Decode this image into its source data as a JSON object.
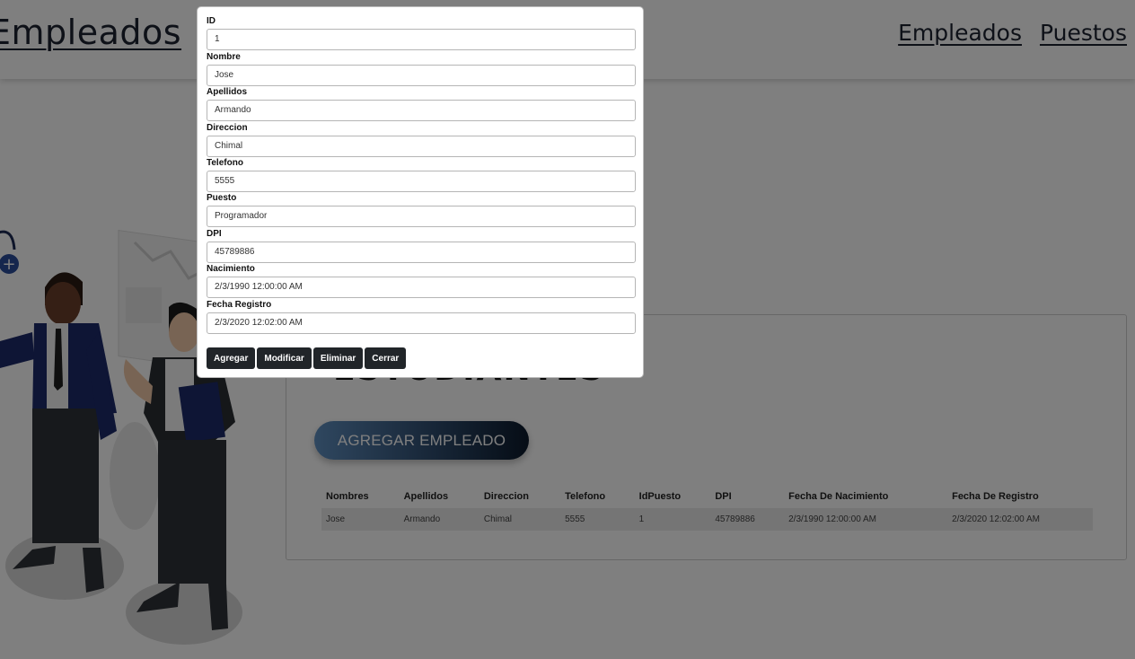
{
  "header": {
    "brand": "Empleados",
    "nav": [
      "Empleados",
      "Puestos"
    ]
  },
  "card": {
    "title": "ESTUDIANTES",
    "add_button": "AGREGAR EMPLEADO",
    "table": {
      "headers": [
        "Nombres",
        "Apellidos",
        "Direccion",
        "Telefono",
        "IdPuesto",
        "DPI",
        "Fecha De Nacimiento",
        "Fecha De Registro"
      ],
      "rows": [
        [
          "Jose",
          "Armando",
          "Chimal",
          "5555",
          "1",
          "45789886",
          "2/3/1990 12:00:00 AM",
          "2/3/2020 12:02:00 AM"
        ]
      ]
    }
  },
  "modal": {
    "fields": [
      {
        "label": "ID",
        "value": "1"
      },
      {
        "label": "Nombre",
        "value": "Jose"
      },
      {
        "label": "Apellidos",
        "value": "Armando"
      },
      {
        "label": "Direccion",
        "value": "Chimal"
      },
      {
        "label": "Telefono",
        "value": "5555"
      },
      {
        "label": "Puesto",
        "value": "Programador"
      },
      {
        "label": "DPI",
        "value": "45789886"
      },
      {
        "label": "Nacimiento",
        "value": "2/3/1990 12:00:00 AM"
      },
      {
        "label": "Fecha Registro",
        "value": "2/3/2020 12:02:00 AM"
      }
    ],
    "buttons": [
      "Agregar",
      "Modificar",
      "Eliminar",
      "Cerrar"
    ]
  },
  "colors": {
    "dark_button": "#212529",
    "overlay": "rgba(0,0,0,0.5)",
    "gradient_start": "#5f8fc0",
    "gradient_end": "#0c1a2c"
  }
}
